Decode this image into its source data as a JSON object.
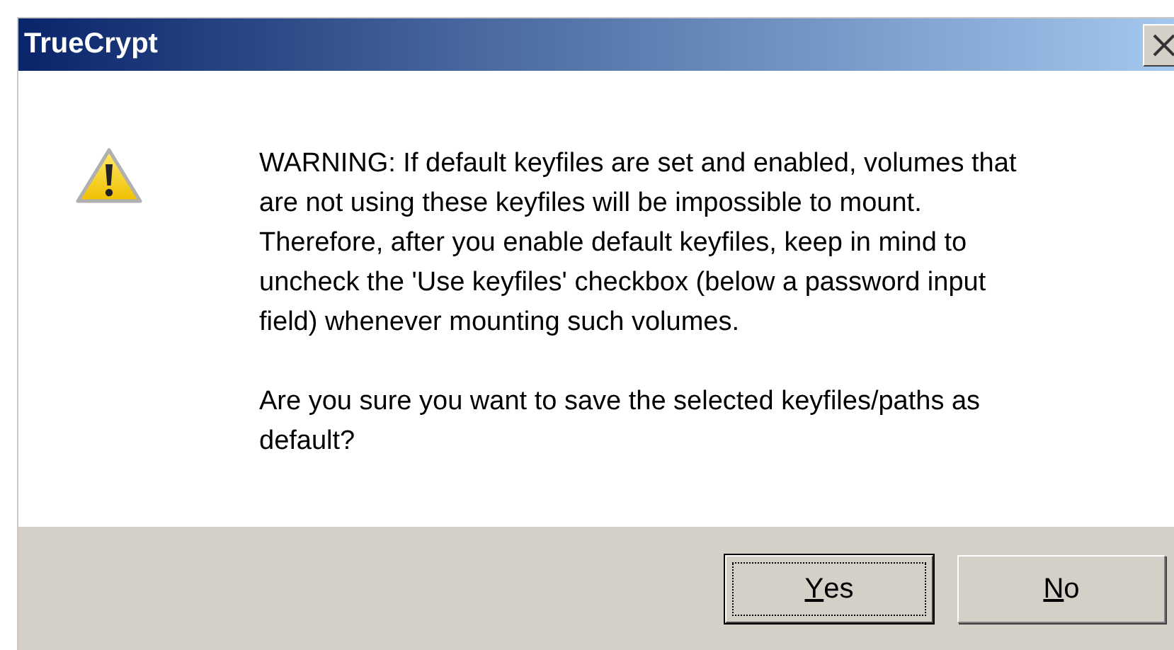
{
  "window": {
    "title": "TrueCrypt"
  },
  "message": {
    "paragraphs": [
      "WARNING: If default keyfiles are set and enabled, volumes that\nare not using these keyfiles will be impossible to mount.\nTherefore, after you enable default keyfiles, keep in mind to\nuncheck the 'Use keyfiles' checkbox (below a password input\nfield) whenever mounting such volumes.",
      "Are you sure you want to save the selected keyfiles/paths as\ndefault?"
    ]
  },
  "buttons": [
    {
      "label": "Yes",
      "focused": true
    },
    {
      "label": "No",
      "focused": false
    }
  ]
}
